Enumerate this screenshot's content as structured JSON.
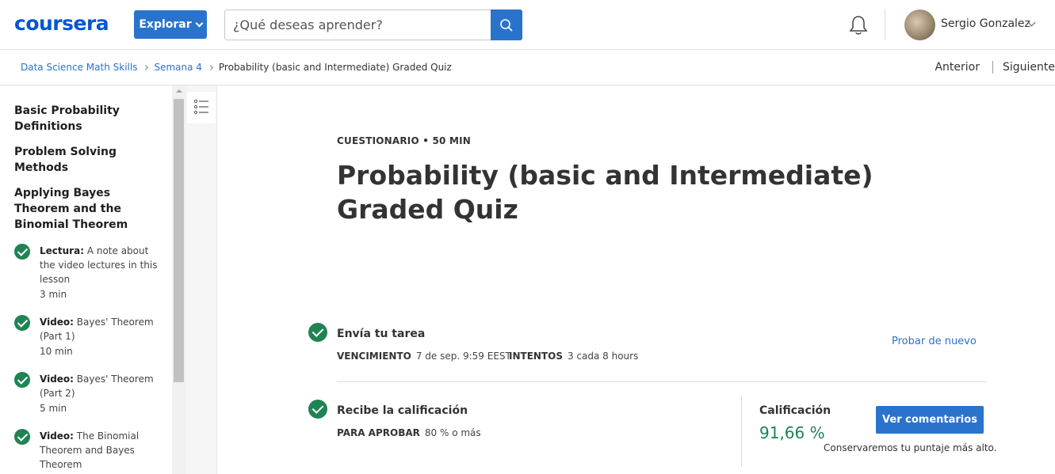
{
  "header": {
    "logo": "coursera",
    "explore_label": "Explorar",
    "search_placeholder": "¿Qué deseas aprender?",
    "user_name": "Sergio Gonzalez"
  },
  "breadcrumb": {
    "course": "Data Science Math Skills",
    "week": "Semana 4",
    "current": "Probability (basic and Intermediate) Graded Quiz",
    "prev": "Anterior",
    "next": "Siguiente"
  },
  "sidebar": {
    "sections": [
      "Basic Probability Definitions",
      "Problem Solving Methods",
      "Applying Bayes Theorem and the Binomial Theorem"
    ],
    "items": [
      {
        "type": "Lectura:",
        "title": "A note about the video lectures in this lesson",
        "duration": "3 min"
      },
      {
        "type": "Video:",
        "title": "Bayes' Theorem (Part 1)",
        "duration": "10 min"
      },
      {
        "type": "Video:",
        "title": "Bayes' Theorem (Part 2)",
        "duration": "5 min"
      },
      {
        "type": "Video:",
        "title": "The Binomial Theorem and Bayes Theorem",
        "duration": ""
      }
    ]
  },
  "main": {
    "kicker": "CUESTIONARIO • 50 MIN",
    "title": "Probability (basic and Intermediate) Graded Quiz",
    "submit": {
      "title": "Envía tu tarea",
      "due_label": "VENCIMIENTO",
      "due_value": "7 de sep. 9:59 EEST",
      "attempts_label": "INTENTOS",
      "attempts_value": "3 cada 8 hours",
      "retry_label": "Probar de nuevo"
    },
    "grade": {
      "title": "Recibe la calificación",
      "pass_label": "PARA APROBAR",
      "pass_value": "80 % o más",
      "grade_label": "Calificación",
      "grade_value": "91,66 %",
      "feedback_button": "Ver comentarios",
      "keep_note": "Conservaremos tu puntaje más alto."
    }
  },
  "colors": {
    "brand": "#0056d2",
    "button": "#2a73cc",
    "success": "#1f8354"
  }
}
